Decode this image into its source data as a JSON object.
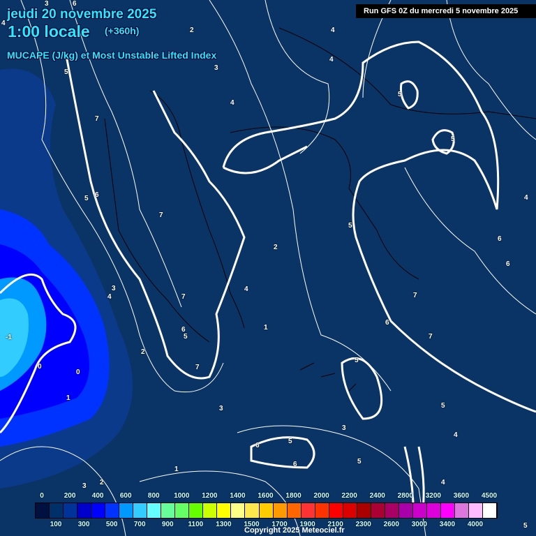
{
  "header": {
    "date": "jeudi 20 novembre 2025",
    "time": "1:00 locale",
    "lead": "(+360h)",
    "title": "MUCAPE (J/kg) et Most Unstable Lifted Index",
    "run": "Run GFS 0Z du mercredi 5 novembre 2025"
  },
  "contour_labels": [
    "3",
    "6",
    "4",
    "2",
    "4",
    "4",
    "5",
    "3",
    "4",
    "5",
    "7",
    "5",
    "6",
    "7",
    "5",
    "2",
    "4",
    "4",
    "3",
    "7",
    "6",
    "5",
    "1",
    "-1",
    "0",
    "0",
    "2",
    "1",
    "7",
    "3",
    "5",
    "6",
    "4",
    "7",
    "5",
    "7",
    "6",
    "6",
    "4",
    "3",
    "5",
    "5",
    "6",
    "6",
    "5",
    "1",
    "3",
    "2",
    "4",
    "5"
  ],
  "legend": {
    "colors": [
      "#001040",
      "#00306a",
      "#003399",
      "#0000cc",
      "#0000ff",
      "#0033ff",
      "#0099ff",
      "#33ccff",
      "#66ffff",
      "#66ff99",
      "#66ff66",
      "#66ff00",
      "#ccff00",
      "#ffff00",
      "#ffff88",
      "#ffe84c",
      "#ffcc00",
      "#ff9900",
      "#ff6600",
      "#ff3333",
      "#ff3300",
      "#ff0000",
      "#dd0000",
      "#aa0000",
      "#aa0033",
      "#aa0066",
      "#aa00aa",
      "#cc00cc",
      "#dd00dd",
      "#ff00ff",
      "#dd77dd",
      "#ffbbff",
      "#ffffff"
    ],
    "top_labels": [
      "0",
      "200",
      "400",
      "600",
      "800",
      "1000",
      "1200",
      "1400",
      "1600",
      "1800",
      "2000",
      "2200",
      "2400",
      "2800",
      "3200",
      "3600",
      "4500"
    ],
    "bottom_labels": [
      "100",
      "300",
      "500",
      "700",
      "900",
      "1100",
      "1300",
      "1500",
      "1700",
      "1900",
      "2100",
      "2300",
      "2600",
      "3000",
      "3400",
      "4000"
    ]
  },
  "copyright": "Copyright 2025 Meteociel.fr"
}
